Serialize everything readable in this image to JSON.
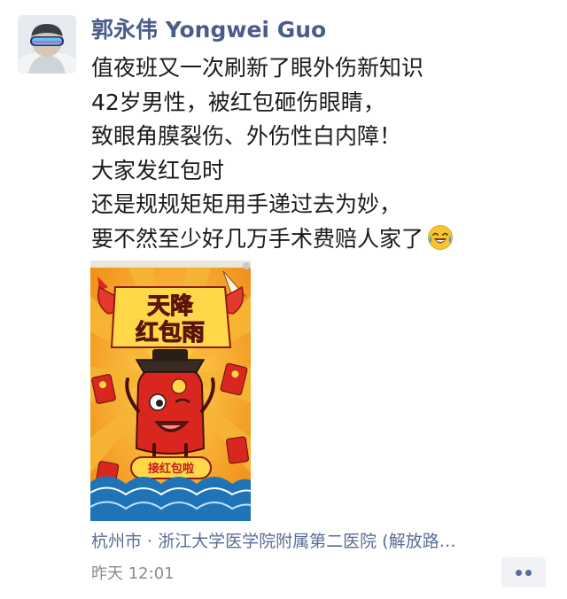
{
  "author": {
    "name": "郭永伟 Yongwei Guo"
  },
  "post": {
    "lines": [
      "值夜班又一次刷新了眼外伤新知识",
      "42岁男性，被红包砸伤眼睛，",
      "致眼角膜裂伤、外伤性白内障！",
      "大家发红包时",
      "还是规规矩矩用手递过去为妙，",
      "要不然至少好几万手术费赔人家了"
    ],
    "emoji": "laugh-cry-emoji"
  },
  "poster": {
    "title_line1": "天降",
    "title_line2": "红包雨",
    "button_label": "接红包啦",
    "colors": {
      "bg": "#f39a21",
      "wing": "#e4392c",
      "envelope": "#d9271f",
      "wave": "#1f74b8"
    }
  },
  "location": "杭州市 · 浙江大学医学院附属第二医院 (解放路…",
  "time": "昨天 12:01",
  "more_button": {
    "icon": "more-dots-icon"
  }
}
